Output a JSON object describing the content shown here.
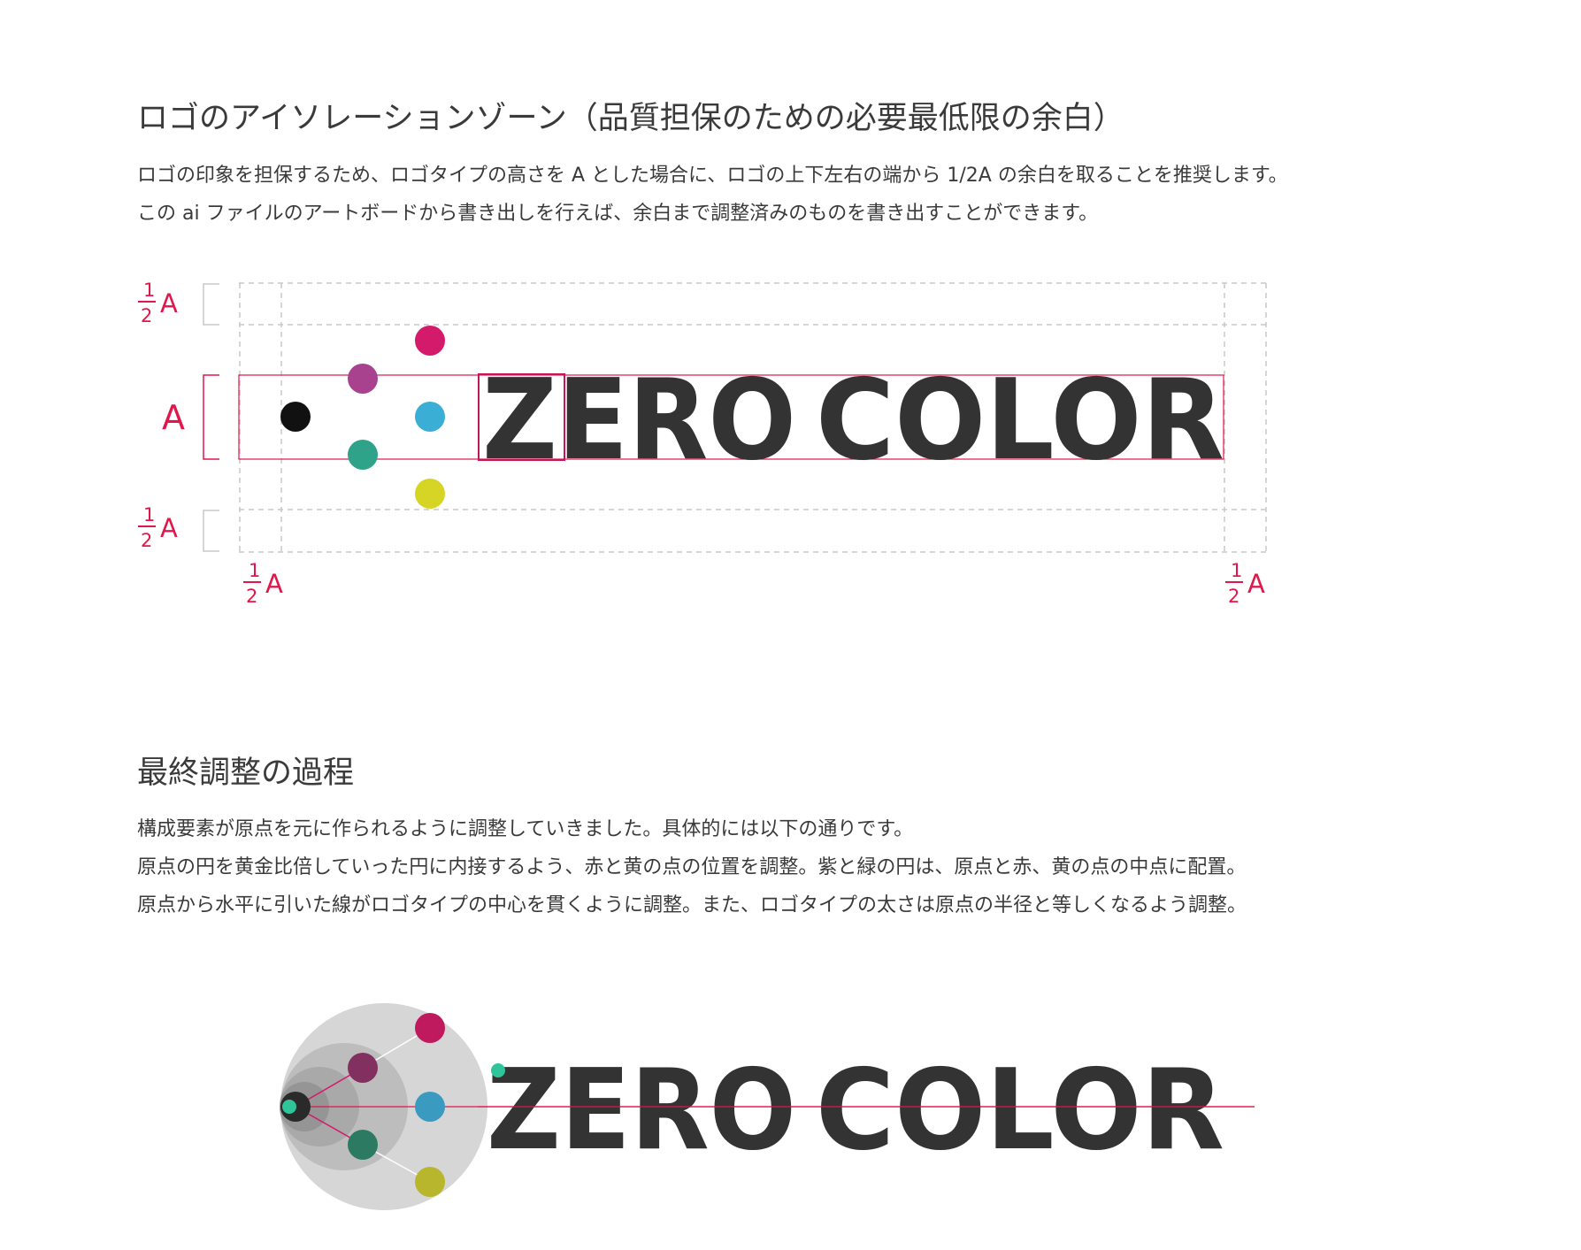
{
  "isolation": {
    "title": "ロゴのアイソレーションゾーン（品質担保のための必要最低限の余白）",
    "description": [
      "ロゴの印象を担保するため、ロゴタイプの高さを A とした場合に、ロゴの上下左右の端から 1/2A の余白を取ることを推奨します。",
      "この ai ファイルのアートボードから書き出しを行えば、余白まで調整済みのものを書き出すことができます。"
    ],
    "diagram": {
      "logo_word1": "ZERO",
      "logo_word2": "COLOR",
      "label_fraction_num": "1",
      "label_fraction_den": "2",
      "label_unit": "A",
      "label_full": "A"
    }
  },
  "adjustment": {
    "title": "最終調整の過程",
    "description": [
      "構成要素が原点を元に作られるように調整していきました。具体的には以下の通りです。",
      "原点の円を黄金比倍していった円に内接するよう、赤と黄の点の位置を調整。紫と緑の円は、原点と赤、黄の点の中点に配置。",
      "原点から水平に引いた線がロゴタイプの中心を貫くように調整。また、ロゴタイプの太さは原点の半径と等しくなるよう調整。"
    ],
    "diagram": {
      "logo_word1": "ZERO",
      "logo_word2": "COLOR"
    }
  },
  "colors": {
    "guide_red": "#e0174a",
    "dot_black": "#111111",
    "dot_magenta": "#d41a6a",
    "dot_purple": "#a8428f",
    "dot_cyan": "#3aaed4",
    "dot_green": "#2fa389",
    "dot_yellow": "#d6d424",
    "logo_text": "#333333",
    "guide_gray": "#c8c8c8"
  }
}
